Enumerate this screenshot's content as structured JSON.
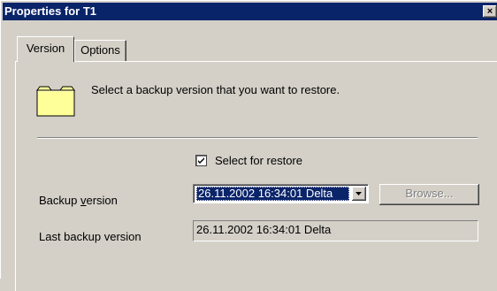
{
  "window": {
    "title": "Properties for T1",
    "close_label": "×"
  },
  "tabs": [
    {
      "label": "Version",
      "selected": true
    },
    {
      "label": "Options",
      "selected": false
    }
  ],
  "version_tab": {
    "icon": "folder-icon",
    "intro_text": "Select a backup version that you want to restore.",
    "select_for_restore": {
      "label": "Select for restore",
      "checked": true
    },
    "backup_version": {
      "label_pre": "Backup ",
      "label_accel": "v",
      "label_post": "ersion",
      "selected_value": "26.11.2002 16:34:01 Delta"
    },
    "browse_button": {
      "label": "Browse...",
      "enabled": false
    },
    "last_backup_version": {
      "label": "Last backup version",
      "value": "26.11.2002 16:34:01 Delta"
    }
  },
  "colors": {
    "titlebar": "#0a246a",
    "face": "#d4d0c8",
    "selection": "#0a246a",
    "folder": "#ffff99"
  }
}
